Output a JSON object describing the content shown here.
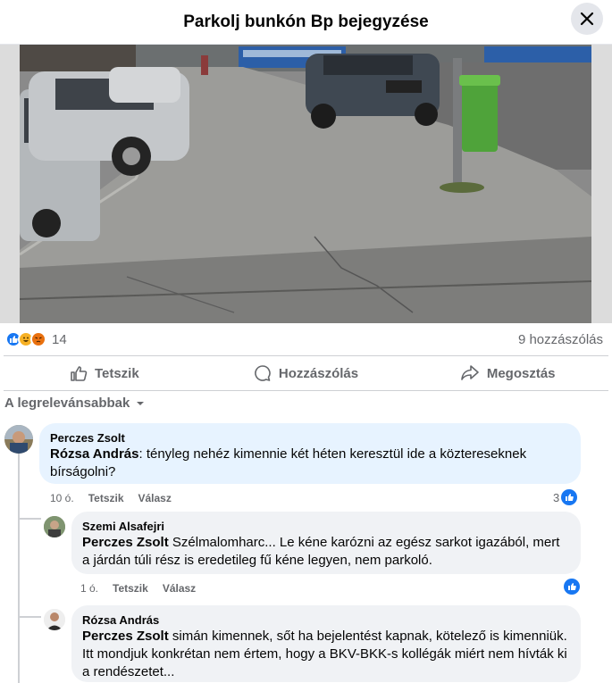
{
  "header": {
    "title": "Parkolj bunkón Bp bejegyzése"
  },
  "post": {
    "reaction_count": "14",
    "comments_count": "9 hozzászólás",
    "actions": {
      "like": "Tetszik",
      "comment": "Hozzászólás",
      "share": "Megosztás"
    }
  },
  "sort": {
    "label": "A legrelevánsabbak"
  },
  "comments": [
    {
      "author": "Perczes Zsolt",
      "mention": "Rózsa András",
      "text": ": tényleg nehéz kimennie két héten keresztül ide a közterеseknek bírságolni?",
      "time": "10 ó.",
      "like_label": "Tetszik",
      "reply_label": "Válasz",
      "likes": "3"
    },
    {
      "author": "Szemi Alsafejri",
      "mention": "Perczes Zsolt",
      "text": " Szélmalomharc... Le kéne karózni az egész sarkot igazából, mert a járdán túli rész is eredetileg fű kéne legyen, nem parkoló.",
      "time": "1 ó.",
      "like_label": "Tetszik",
      "reply_label": "Válasz",
      "likes": ""
    },
    {
      "author": "Rózsa András",
      "mention": "Perczes Zsolt",
      "text": " simán kimennek, sőt ha bejelentést kapnak, kötelező is kimenniük. Itt mondjuk konkrétan nem értem, hogy a BKV-BKK-s kollégák miért nem hívták ki a rendészetet..."
    }
  ]
}
